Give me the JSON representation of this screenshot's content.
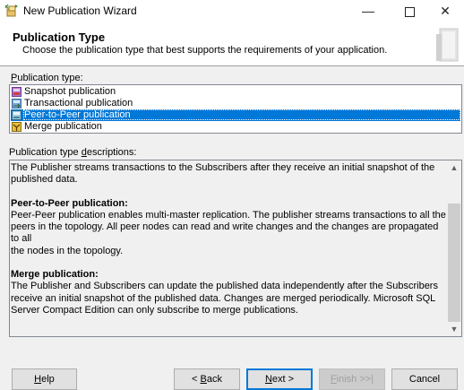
{
  "window": {
    "title": "New Publication Wizard",
    "controls": {
      "minimize": "—",
      "close": "✕"
    }
  },
  "header": {
    "title": "Publication Type",
    "subtitle": "Choose the publication type that best supports the requirements of your application."
  },
  "publication_type_label": {
    "accesskey": "P",
    "rest": "ublication type:"
  },
  "publication_types": [
    {
      "label": "Snapshot publication",
      "icon": "snapshot-publication-icon",
      "selected": false
    },
    {
      "label": "Transactional publication",
      "icon": "transactional-publication-icon",
      "selected": false
    },
    {
      "label": "Peer-to-Peer publication",
      "icon": "peer-to-peer-publication-icon",
      "selected": true
    },
    {
      "label": "Merge publication",
      "icon": "merge-publication-icon",
      "selected": false
    }
  ],
  "descriptions_label": {
    "before": "Publication type ",
    "accesskey": "d",
    "after": "escriptions:"
  },
  "descriptions": {
    "intro_line1": "The Publisher streams transactions to the Subscribers after they receive an initial snapshot of the",
    "intro_line2": "published data.",
    "p2p_heading": "Peer-to-Peer publication:",
    "p2p_line1": "Peer-Peer publication enables multi-master replication. The publisher streams transactions to all the",
    "p2p_line2": "peers in the topology. All peer nodes can read and write changes and the changes are propagated to all",
    "p2p_line3": "the nodes in the topology.",
    "merge_heading": "Merge publication:",
    "merge_line1": "The Publisher and Subscribers can update the published data independently after the Subscribers",
    "merge_line2": "receive an initial snapshot of the published data. Changes are merged periodically. Microsoft SQL",
    "merge_line3": "Server Compact Edition can only subscribe to merge publications."
  },
  "buttons": {
    "help": {
      "accesskey": "H",
      "rest": "elp"
    },
    "back": {
      "prefix": "< ",
      "accesskey": "B",
      "rest": "ack"
    },
    "next": {
      "accesskey": "N",
      "rest": "ext >"
    },
    "finish": {
      "accesskey": "F",
      "rest": "inish >>|"
    },
    "cancel": "Cancel"
  },
  "colors": {
    "selection": "#0078d7",
    "window": "#f0f0f0"
  }
}
